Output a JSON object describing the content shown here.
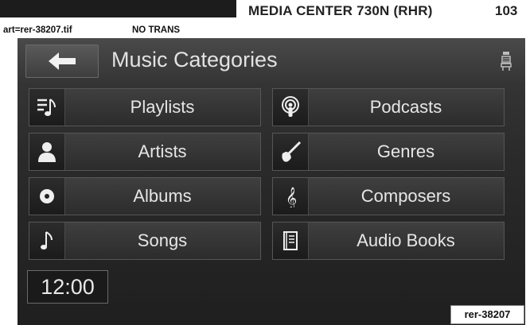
{
  "header": {
    "title": "MEDIA CENTER 730N (RHR)",
    "page_number": "103",
    "art_label": "art=rer-38207.tif",
    "trans_label": "NO TRANS"
  },
  "screen": {
    "title": "Music Categories",
    "back_icon": "back-arrow-icon",
    "seat_icon": "seat-icon",
    "categories": [
      {
        "label": "Playlists",
        "icon": "playlist-icon"
      },
      {
        "label": "Podcasts",
        "icon": "podcast-icon"
      },
      {
        "label": "Artists",
        "icon": "artist-icon"
      },
      {
        "label": "Genres",
        "icon": "guitar-icon"
      },
      {
        "label": "Albums",
        "icon": "album-disc-icon"
      },
      {
        "label": "Composers",
        "icon": "treble-clef-icon"
      },
      {
        "label": "Songs",
        "icon": "music-note-icon"
      },
      {
        "label": "Audio Books",
        "icon": "book-icon"
      }
    ],
    "clock": "12:00"
  },
  "reference_tag": "rer-38207"
}
